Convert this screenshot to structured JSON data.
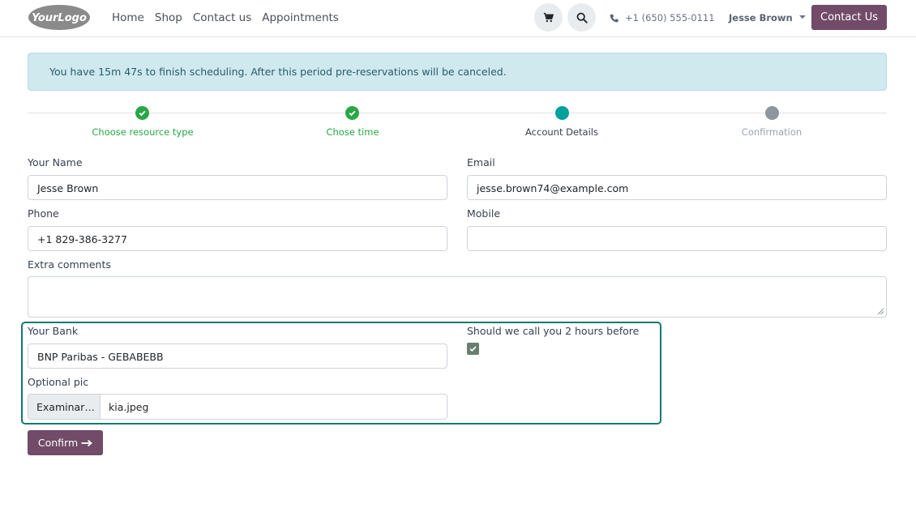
{
  "header": {
    "logo_text": "YourLogo",
    "nav": [
      "Home",
      "Shop",
      "Contact us",
      "Appointments"
    ],
    "phone": "+1 (650) 555-0111",
    "user": "Jesse Brown",
    "contact_button": "Contact Us",
    "icons": [
      "cart-icon",
      "search-icon",
      "phone-icon",
      "caret-down-icon"
    ]
  },
  "alert": {
    "text": "You have 15m 47s to finish scheduling. After this period pre-reservations will be canceled."
  },
  "progress": {
    "steps": [
      {
        "label": "Choose resource type",
        "state": "done"
      },
      {
        "label": "Chose time",
        "state": "done"
      },
      {
        "label": "Account Details",
        "state": "current"
      },
      {
        "label": "Confirmation",
        "state": "pending"
      }
    ]
  },
  "form": {
    "name_label": "Your Name",
    "name_value": "Jesse Brown",
    "email_label": "Email",
    "email_value": "jesse.brown74@example.com",
    "phone_label": "Phone",
    "phone_value": "+1 829-386-3277",
    "mobile_label": "Mobile",
    "mobile_value": "",
    "comments_label": "Extra comments",
    "bank_label": "Your Bank",
    "bank_value": "BNP Paribas - GEBABEBB",
    "call_label": "Should we call you 2 hours before",
    "call_checked": true,
    "pic_label": "Optional pic",
    "pic_button": "Examinar…",
    "pic_file": "kia.jpeg",
    "confirm_button": "Confirm"
  },
  "colors": {
    "brand": "#714b67",
    "success": "#28a745",
    "current": "#00a09d",
    "pending": "#8f959e",
    "alert_bg": "#cfe9ee",
    "highlight_border": "#107a73"
  }
}
